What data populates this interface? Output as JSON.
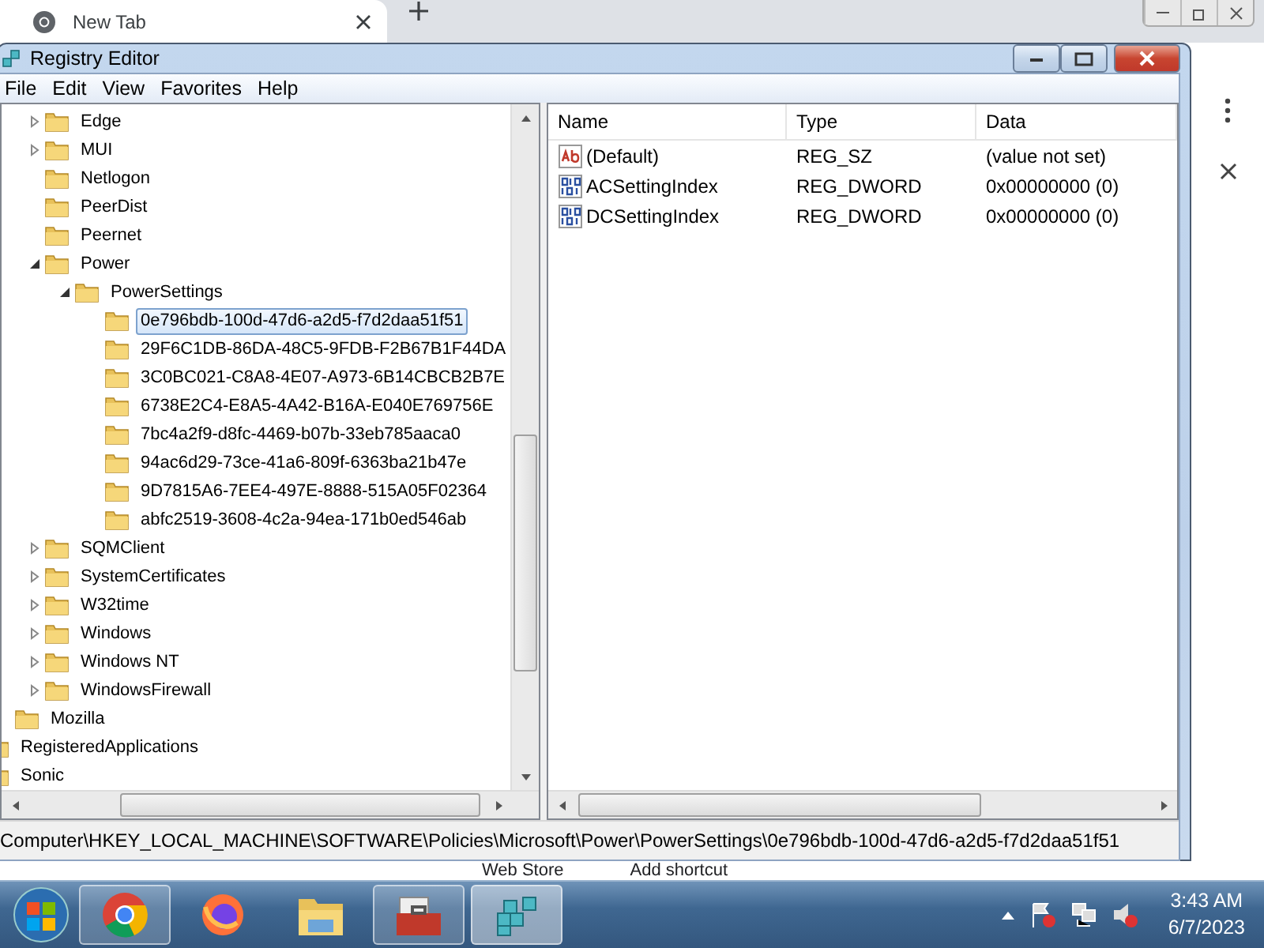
{
  "browser": {
    "tab": {
      "title": "New Tab"
    },
    "shortcuts": [
      "Web Store",
      "Add shortcut"
    ]
  },
  "window": {
    "title": "Registry Editor"
  },
  "menu": [
    "File",
    "Edit",
    "View",
    "Favorites",
    "Help"
  ],
  "tree": [
    {
      "children": [
        {
          "children": [
            {
              "label": "Edge",
              "expandable": true,
              "expanded": false,
              "selected": false
            },
            {
              "label": "MUI",
              "expandable": true,
              "expanded": false,
              "selected": false
            },
            {
              "label": "Netlogon",
              "expandable": false,
              "expanded": false,
              "selected": false
            },
            {
              "label": "PeerDist",
              "expandable": false,
              "expanded": false,
              "selected": false
            },
            {
              "label": "Peernet",
              "expandable": false,
              "expanded": false,
              "selected": false
            },
            {
              "label": "Power",
              "expandable": true,
              "expanded": true,
              "selected": false,
              "children": [
                {
                  "label": "PowerSettings",
                  "expandable": true,
                  "expanded": true,
                  "selected": false,
                  "children": [
                    {
                      "label": "0e796bdb-100d-47d6-a2d5-f7d2daa51f51",
                      "expandable": false,
                      "expanded": false,
                      "selected": true
                    },
                    {
                      "label": "29F6C1DB-86DA-48C5-9FDB-F2B67B1F44DA",
                      "expandable": false,
                      "expanded": false,
                      "selected": false
                    },
                    {
                      "label": "3C0BC021-C8A8-4E07-A973-6B14CBCB2B7E",
                      "expandable": false,
                      "expanded": false,
                      "selected": false
                    },
                    {
                      "label": "6738E2C4-E8A5-4A42-B16A-E040E769756E",
                      "expandable": false,
                      "expanded": false,
                      "selected": false
                    },
                    {
                      "label": "7bc4a2f9-d8fc-4469-b07b-33eb785aaca0",
                      "expandable": false,
                      "expanded": false,
                      "selected": false
                    },
                    {
                      "label": "94ac6d29-73ce-41a6-809f-6363ba21b47e",
                      "expandable": false,
                      "expanded": false,
                      "selected": false
                    },
                    {
                      "label": "9D7815A6-7EE4-497E-8888-515A05F02364",
                      "expandable": false,
                      "expanded": false,
                      "selected": false
                    },
                    {
                      "label": "abfc2519-3608-4c2a-94ea-171b0ed546ab",
                      "expandable": false,
                      "expanded": false,
                      "selected": false
                    }
                  ]
                }
              ]
            },
            {
              "label": "SQMClient",
              "expandable": true,
              "expanded": false,
              "selected": false
            },
            {
              "label": "SystemCertificates",
              "expandable": true,
              "expanded": false,
              "selected": false
            },
            {
              "label": "W32time",
              "expandable": true,
              "expanded": false,
              "selected": false
            },
            {
              "label": "Windows",
              "expandable": true,
              "expanded": false,
              "selected": false
            },
            {
              "label": "Windows NT",
              "expandable": true,
              "expanded": false,
              "selected": false
            },
            {
              "label": "WindowsFirewall",
              "expandable": true,
              "expanded": false,
              "selected": false
            }
          ]
        },
        {
          "label": "Mozilla",
          "expandable": false,
          "expanded": false,
          "selected": false
        }
      ]
    },
    {
      "label": "RegisteredApplications",
      "expandable": false,
      "expanded": false,
      "selected": false
    },
    {
      "label": "Sonic",
      "expandable": false,
      "expanded": false,
      "selected": false
    }
  ],
  "values": {
    "columns": [
      "Name",
      "Type",
      "Data"
    ],
    "rows": [
      {
        "kind": "string",
        "name": "(Default)",
        "type": "REG_SZ",
        "data": "(value not set)"
      },
      {
        "kind": "binary",
        "name": "ACSettingIndex",
        "type": "REG_DWORD",
        "data": "0x00000000 (0)"
      },
      {
        "kind": "binary",
        "name": "DCSettingIndex",
        "type": "REG_DWORD",
        "data": "0x00000000 (0)"
      }
    ]
  },
  "status_bar": "Computer\\HKEY_LOCAL_MACHINE\\SOFTWARE\\Policies\\Microsoft\\Power\\PowerSettings\\0e796bdb-100d-47d6-a2d5-f7d2daa51f51",
  "taskbar": {
    "apps": [
      {
        "kind": "chrome",
        "running": true,
        "selected": false
      },
      {
        "kind": "firefox",
        "running": false,
        "selected": false
      },
      {
        "kind": "explorer",
        "running": false,
        "selected": false
      },
      {
        "kind": "toolbox",
        "running": true,
        "selected": false
      },
      {
        "kind": "regedit",
        "running": true,
        "selected": true
      }
    ],
    "clock": {
      "time": "3:43 AM",
      "date": "6/7/2023"
    }
  }
}
